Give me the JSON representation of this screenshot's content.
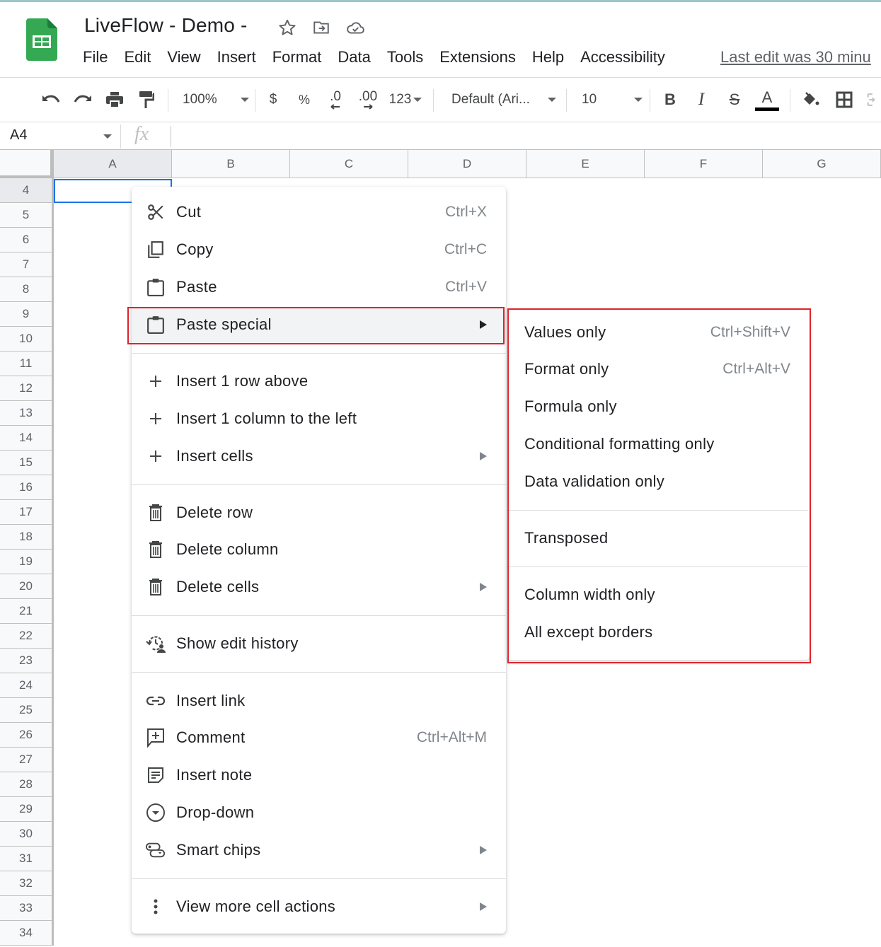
{
  "header": {
    "title": "LiveFlow - Demo -",
    "title_icons": [
      "star-icon",
      "move-to-folder-icon",
      "cloud-saved-icon"
    ],
    "menu": [
      "File",
      "Edit",
      "View",
      "Insert",
      "Format",
      "Data",
      "Tools",
      "Extensions",
      "Help",
      "Accessibility"
    ],
    "last_edit": "Last edit was 30 minu"
  },
  "toolbar": {
    "zoom": "100%",
    "currency": "$",
    "percent": "%",
    "decrease_decimal": ".0",
    "increase_decimal": ".00",
    "number_format": "123",
    "font": "Default (Ari...",
    "font_size": "10",
    "bold": "B",
    "italic": "I",
    "strike": "S",
    "text_color": "A",
    "text_color_value": "#000000"
  },
  "formula_bar": {
    "name_box": "A4",
    "fx": "fx",
    "value": ""
  },
  "grid": {
    "columns": [
      "A",
      "B",
      "C",
      "D",
      "E",
      "F",
      "G"
    ],
    "rows": [
      "4",
      "5",
      "6",
      "7",
      "8",
      "9",
      "10",
      "11",
      "12",
      "13",
      "14",
      "15",
      "16",
      "17",
      "18",
      "19",
      "20",
      "21",
      "22",
      "23",
      "24",
      "25",
      "26",
      "27",
      "28",
      "29",
      "30",
      "31",
      "32",
      "33",
      "34"
    ],
    "selected_cell": "A4"
  },
  "context_menu": {
    "items": [
      {
        "label": "Cut",
        "shortcut": "Ctrl+X",
        "icon": "scissors-icon"
      },
      {
        "label": "Copy",
        "shortcut": "Ctrl+C",
        "icon": "copy-icon"
      },
      {
        "label": "Paste",
        "shortcut": "Ctrl+V",
        "icon": "clipboard-icon"
      },
      {
        "label": "Paste special",
        "shortcut": "",
        "icon": "clipboard-icon",
        "submenu": true,
        "highlighted": true
      },
      {
        "label": "Insert 1 row above",
        "shortcut": "",
        "icon": "plus-icon"
      },
      {
        "label": "Insert 1 column to the left",
        "shortcut": "",
        "icon": "plus-icon"
      },
      {
        "label": "Insert cells",
        "shortcut": "",
        "icon": "plus-icon",
        "submenu": true
      },
      {
        "label": "Delete row",
        "shortcut": "",
        "icon": "trash-icon"
      },
      {
        "label": "Delete column",
        "shortcut": "",
        "icon": "trash-icon"
      },
      {
        "label": "Delete cells",
        "shortcut": "",
        "icon": "trash-icon",
        "submenu": true
      },
      {
        "label": "Show edit history",
        "shortcut": "",
        "icon": "edit-history-icon"
      },
      {
        "label": "Insert link",
        "shortcut": "",
        "icon": "link-icon"
      },
      {
        "label": "Comment",
        "shortcut": "Ctrl+Alt+M",
        "icon": "comment-icon"
      },
      {
        "label": "Insert note",
        "shortcut": "",
        "icon": "note-icon"
      },
      {
        "label": "Drop-down",
        "shortcut": "",
        "icon": "dropdown-icon"
      },
      {
        "label": "Smart chips",
        "shortcut": "",
        "icon": "smart-chips-icon",
        "submenu": true
      },
      {
        "label": "View more cell actions",
        "shortcut": "",
        "icon": "more-vert-icon",
        "submenu": true
      }
    ]
  },
  "paste_special_menu": {
    "items": [
      {
        "label": "Values only",
        "shortcut": "Ctrl+Shift+V"
      },
      {
        "label": "Format only",
        "shortcut": "Ctrl+Alt+V"
      },
      {
        "label": "Formula only",
        "shortcut": ""
      },
      {
        "label": "Conditional formatting only",
        "shortcut": ""
      },
      {
        "label": "Data validation only",
        "shortcut": ""
      },
      {
        "label": "Transposed",
        "shortcut": ""
      },
      {
        "label": "Column width only",
        "shortcut": ""
      },
      {
        "label": "All except borders",
        "shortcut": ""
      }
    ]
  },
  "colors": {
    "highlight_border": "#e0232b",
    "selection": "#1a73e8",
    "sheets_green": "#34a853"
  }
}
